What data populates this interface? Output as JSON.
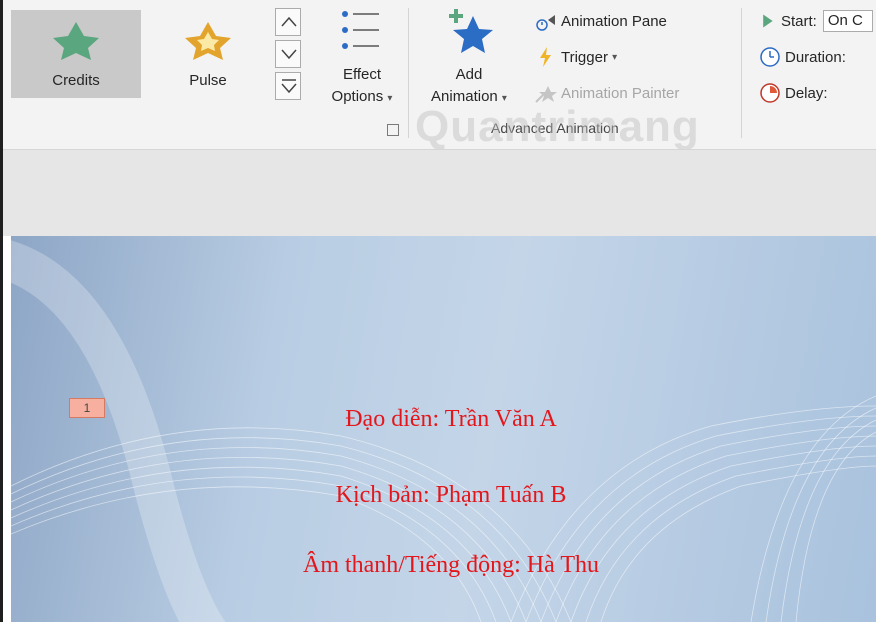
{
  "ribbon": {
    "gallery": [
      {
        "label": "Credits",
        "icon": "green-star-icon",
        "selected": true
      },
      {
        "label": "Pulse",
        "icon": "pulse-star-icon",
        "selected": false
      }
    ],
    "effect_options": {
      "line1": "Effect",
      "line2": "Options",
      "arrow": "▾"
    },
    "add_animation": {
      "line1": "Add",
      "line2": "Animation",
      "arrow": "▾"
    },
    "advanced": {
      "animation_pane": "Animation Pane",
      "trigger": "Trigger",
      "trigger_arrow": "▾",
      "animation_painter": "Animation Painter",
      "group_label": "Advanced Animation"
    },
    "timing": {
      "start_label": "Start:",
      "start_value": "On C",
      "duration_label": "Duration:",
      "delay_label": "Delay:"
    },
    "watermark": "Quantrimang"
  },
  "slide": {
    "animation_badge": "1",
    "credits": [
      "Đạo diễn: Trần Văn A",
      "Kịch bản: Phạm Tuấn B",
      "Âm thanh/Tiếng động: Hà Thu"
    ],
    "text_color": "#e3161b"
  },
  "colors": {
    "accent_blue": "#2b6cc4",
    "star_green": "#5aa67e",
    "pulse_gold": "#e2a42c"
  }
}
